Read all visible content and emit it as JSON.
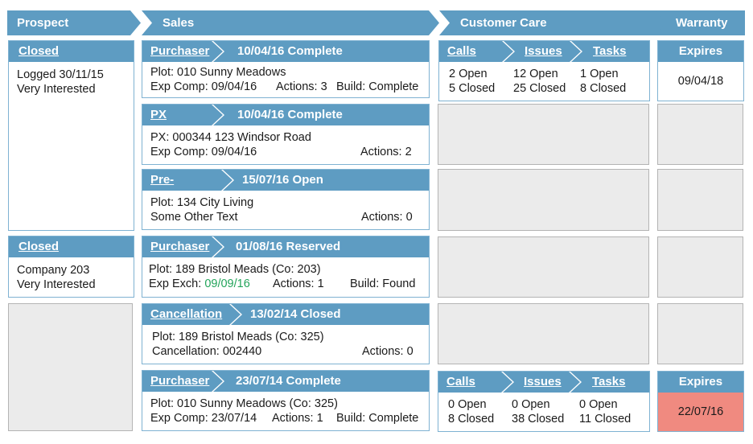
{
  "columns": {
    "prospect": "Prospect",
    "sales": "Sales",
    "customer_care": "Customer Care",
    "warranty": "Warranty"
  },
  "prospect": [
    {
      "status": "Closed",
      "line1": "Logged 30/11/15",
      "line2": "Very Interested"
    },
    {
      "status": "Closed",
      "line1": "Company 203",
      "line2": "Very Interested"
    }
  ],
  "sales": [
    {
      "type": "Purchaser",
      "title": "10/04/16 Complete",
      "line1": "Plot: 010 Sunny Meadows",
      "line2a": "Exp Comp: 09/04/16",
      "line2b": "Actions: 3",
      "line2c": "Build: Complete"
    },
    {
      "type": "PX Seller",
      "title": "10/04/16 Complete",
      "line1": "PX: 000344 123 Windsor Road",
      "line2a": "Exp Comp: 09/04/16",
      "line2b": "Actions: 2"
    },
    {
      "type": "Pre-release",
      "title": "15/07/16 Open",
      "line1": "Plot: 134 City Living",
      "line2a": "Some Other Text",
      "line2b": "Actions: 0"
    },
    {
      "type": "Purchaser",
      "title": "01/08/16 Reserved",
      "line1": "Plot: 189 Bristol Meads (Co: 203)",
      "line2_prefix": "Exp Exch: ",
      "line2_date": "09/09/16",
      "line2b": "Actions: 1",
      "line2c": "Build: Found"
    },
    {
      "type": "Cancellation",
      "title": "13/02/14 Closed",
      "line1": "Plot: 189 Bristol Meads (Co: 325)",
      "line2a": "Cancellation: 002440",
      "line2b": "Actions: 0"
    },
    {
      "type": "Purchaser",
      "title": "23/07/14 Complete",
      "line1": "Plot: 010 Sunny Meadows (Co: 325)",
      "line2a": "Exp Comp: 23/07/14",
      "line2b": "Actions: 1",
      "line2c": "Build: Complete"
    }
  ],
  "customer_care": [
    {
      "calls_label": "Calls",
      "issues_label": "Issues",
      "tasks_label": "Tasks",
      "calls_open": "2 Open",
      "calls_closed": "5 Closed",
      "issues_open": "12 Open",
      "issues_closed": "25 Closed",
      "tasks_open": "1 Open",
      "tasks_closed": "8 Closed"
    },
    {
      "calls_label": "Calls",
      "issues_label": "Issues",
      "tasks_label": "Tasks",
      "calls_open": "0 Open",
      "calls_closed": "8 Closed",
      "issues_open": "0 Open",
      "issues_closed": "38 Closed",
      "tasks_open": "0 Open",
      "tasks_closed": "11 Closed"
    }
  ],
  "warranty": [
    {
      "label": "Expires",
      "date": "09/04/18"
    },
    {
      "label": "Expires",
      "date": "22/07/16"
    }
  ],
  "colors": {
    "header_blue": "#5e9cc2",
    "empty_grey": "#ebebeb",
    "expired_red": "#f08a80",
    "date_green": "#23a45a"
  }
}
